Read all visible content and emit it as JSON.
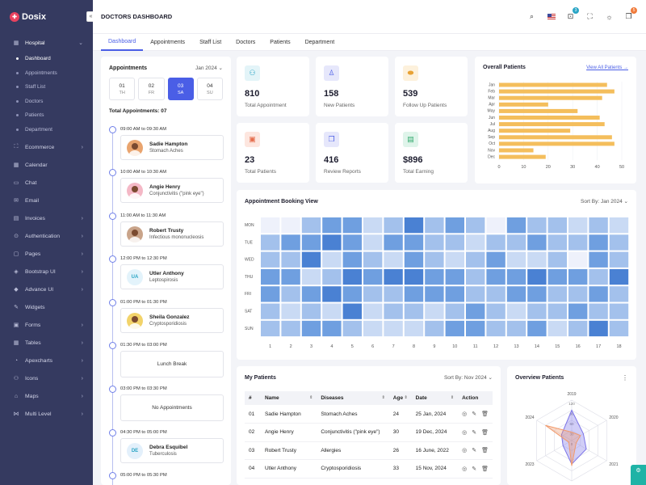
{
  "app": {
    "logo_text": "Dosix",
    "collapse_icon": "«"
  },
  "sidebar": {
    "group_label": "Hospital",
    "subitems": [
      "Dashboard",
      "Appointments",
      "Staff List",
      "Doctors",
      "Patients",
      "Department"
    ],
    "items": [
      {
        "label": "Ecommerce",
        "icon": "cart-icon",
        "glyph": "⛶",
        "chevron": true
      },
      {
        "label": "Calendar",
        "icon": "calendar-icon",
        "glyph": "▦",
        "chevron": false
      },
      {
        "label": "Chat",
        "icon": "chat-icon",
        "glyph": "▭",
        "chevron": false
      },
      {
        "label": "Email",
        "icon": "email-icon",
        "glyph": "✉",
        "chevron": false
      },
      {
        "label": "Invoices",
        "icon": "invoice-icon",
        "glyph": "▤",
        "chevron": true
      },
      {
        "label": "Authentication",
        "icon": "lock-icon",
        "glyph": "⊙",
        "chevron": true
      },
      {
        "label": "Pages",
        "icon": "pages-icon",
        "glyph": "▢",
        "chevron": true
      },
      {
        "label": "Bootstrap UI",
        "icon": "box-icon",
        "glyph": "◈",
        "chevron": true
      },
      {
        "label": "Advance UI",
        "icon": "layers-icon",
        "glyph": "◆",
        "chevron": true
      },
      {
        "label": "Widgets",
        "icon": "widgets-icon",
        "glyph": "✎",
        "chevron": false
      },
      {
        "label": "Forms",
        "icon": "forms-icon",
        "glyph": "▣",
        "chevron": true
      },
      {
        "label": "Tables",
        "icon": "table-icon",
        "glyph": "▦",
        "chevron": true
      },
      {
        "label": "Apexcharts",
        "icon": "chart-icon",
        "glyph": "◔",
        "chevron": true
      },
      {
        "label": "Icons",
        "icon": "star-icon",
        "glyph": "⚇",
        "chevron": true
      },
      {
        "label": "Maps",
        "icon": "map-icon",
        "glyph": "⌂",
        "chevron": true
      },
      {
        "label": "Multi Level",
        "icon": "share-icon",
        "glyph": "⋈",
        "chevron": true
      }
    ]
  },
  "header": {
    "title": "DOCTORS DASHBOARD",
    "cart_badge": "3",
    "notif_badge": "5"
  },
  "tabs": [
    "Dashboard",
    "Appointments",
    "Staff List",
    "Doctors",
    "Patients",
    "Department"
  ],
  "appointments": {
    "title": "Appointments",
    "month": "Jan 2024",
    "days": [
      {
        "num": "01",
        "dow": "TH"
      },
      {
        "num": "02",
        "dow": "FR"
      },
      {
        "num": "03",
        "dow": "SA"
      },
      {
        "num": "04",
        "dow": "SU"
      }
    ],
    "total": "Total Appointments: 07",
    "slots": [
      {
        "time": "09:00 AM to 09:30 AM",
        "name": "Sadie Hampton",
        "disease": "Stomach Aches",
        "avatar": "photo",
        "avatar_color": "#e9a46e"
      },
      {
        "time": "10:00 AM to 10:30 AM",
        "name": "Angie Henry",
        "disease": "Conjunctivitis (\"pink eye\")",
        "avatar": "photo",
        "avatar_color": "#f4b8c6"
      },
      {
        "time": "11:00 AM to 11:30 AM",
        "name": "Robert Trusty",
        "disease": "Infectious mononucleosis",
        "avatar": "photo",
        "avatar_color": "#c9a48a"
      },
      {
        "time": "12:00 PM to 12:30 PM",
        "name": "Utler Anthony",
        "disease": "Leptospirosis",
        "avatar": "UA",
        "avatar_color": "#e3f3fb"
      },
      {
        "time": "01:00 PM to 01:30 PM",
        "name": "Sheila Gonzalez",
        "disease": "Cryptosporidiosis",
        "avatar": "photo",
        "avatar_color": "#f2d36a"
      },
      {
        "time": "01:30 PM to 03:00 PM",
        "note": "Lunch Break"
      },
      {
        "time": "03:00 PM to 03:30 PM",
        "note": "No Appointments"
      },
      {
        "time": "04:30 PM to 05:00 PM",
        "name": "Debra Esquibel",
        "disease": "Tuberculosis",
        "avatar": "DE",
        "avatar_color": "#e3f0fb"
      },
      {
        "time": "05:00 PM to 05:30 PM"
      }
    ]
  },
  "stats": [
    {
      "value": "810",
      "label": "Total Appointment",
      "icon": "users-icon",
      "glyph": "⚇",
      "bg": "#e3f4f8",
      "fg": "#2aa5c5"
    },
    {
      "value": "158",
      "label": "New Patients",
      "icon": "user-icon",
      "glyph": "♙",
      "bg": "#e6e7fb",
      "fg": "#4a5ee6"
    },
    {
      "value": "539",
      "label": "Follow Up Patients",
      "icon": "pill-icon",
      "glyph": "⬬",
      "bg": "#fdf1dc",
      "fg": "#e8a235"
    },
    {
      "value": "23",
      "label": "Total Patients",
      "icon": "monitor-icon",
      "glyph": "▣",
      "bg": "#fde6df",
      "fg": "#e56b4b"
    },
    {
      "value": "416",
      "label": "Review Reports",
      "icon": "files-icon",
      "glyph": "❐",
      "bg": "#e6e7fb",
      "fg": "#4a5ee6"
    },
    {
      "value": "$896",
      "label": "Total Earning",
      "icon": "wallet-icon",
      "glyph": "▤",
      "bg": "#dff4ea",
      "fg": "#2fa86b"
    }
  ],
  "overall": {
    "title": "Overall Patients",
    "link": "View All Patients →"
  },
  "heatmap_card": {
    "title": "Appointment Booking View",
    "sort_label": "Sort By:",
    "sort_value": "Jan 2024"
  },
  "patients": {
    "title": "My Patients",
    "sort_label": "Sort By:",
    "sort_value": "Nov 2024",
    "columns": [
      "#",
      "Name",
      "Diseases",
      "Age",
      "Date",
      "Action"
    ],
    "rows": [
      [
        "01",
        "Sadie Hampton",
        "Stomach Aches",
        "24",
        "25 Jan, 2024"
      ],
      [
        "02",
        "Angie Henry",
        "Conjunctivitis (\"pink eye\")",
        "30",
        "19 Dec, 2024"
      ],
      [
        "03",
        "Robert Trusty",
        "Allergies",
        "26",
        "16 June, 2022"
      ],
      [
        "04",
        "Utler Anthony",
        "Cryptosporidiosis",
        "33",
        "15 Nov, 2024"
      ]
    ]
  },
  "overview": {
    "title": "Overview Patients"
  },
  "chart_data": [
    {
      "type": "bar",
      "orientation": "horizontal",
      "categories": [
        "Jan",
        "Feb",
        "Mar",
        "Apr",
        "May",
        "Jun",
        "Jul",
        "Aug",
        "Sep",
        "Oct",
        "Nov",
        "Dec"
      ],
      "values": [
        44,
        47,
        42,
        20,
        32,
        41,
        43,
        29,
        46,
        47,
        14,
        19
      ],
      "xlim": [
        0,
        50
      ],
      "xticks": [
        0,
        10,
        20,
        30,
        40,
        50
      ],
      "color": "#f4be5c"
    },
    {
      "type": "heatmap",
      "rows": [
        "MON",
        "TUE",
        "WED",
        "THU",
        "FRI",
        "SAT",
        "SUN"
      ],
      "columns": [
        "1",
        "2",
        "3",
        "4",
        "5",
        "6",
        "7",
        "8",
        "9",
        "10",
        "11",
        "12",
        "13",
        "14",
        "15",
        "16",
        "17",
        "18"
      ],
      "values": [
        [
          0,
          0,
          2,
          3,
          3,
          1,
          2,
          4,
          2,
          3,
          2,
          0,
          3,
          2,
          2,
          1,
          2,
          1
        ],
        [
          2,
          3,
          3,
          4,
          3,
          1,
          3,
          3,
          2,
          2,
          1,
          2,
          2,
          3,
          2,
          2,
          3,
          2
        ],
        [
          2,
          2,
          4,
          1,
          3,
          2,
          1,
          3,
          2,
          1,
          2,
          3,
          1,
          1,
          2,
          0,
          3,
          2
        ],
        [
          3,
          3,
          1,
          2,
          4,
          3,
          4,
          4,
          3,
          3,
          2,
          3,
          3,
          4,
          3,
          3,
          2,
          4
        ],
        [
          3,
          2,
          3,
          4,
          3,
          2,
          2,
          3,
          3,
          3,
          2,
          2,
          3,
          3,
          2,
          2,
          3,
          2
        ],
        [
          2,
          1,
          2,
          1,
          4,
          1,
          2,
          2,
          1,
          2,
          3,
          2,
          1,
          2,
          2,
          3,
          2,
          2
        ],
        [
          2,
          2,
          3,
          3,
          2,
          1,
          1,
          1,
          2,
          3,
          3,
          2,
          2,
          3,
          1,
          2,
          4,
          2
        ]
      ],
      "palette": [
        "#eef1fb",
        "#c9daf4",
        "#a3c1ec",
        "#6f9fe0",
        "#4a81d3"
      ]
    },
    {
      "type": "radar",
      "axes": [
        "2019",
        "2020",
        "2021",
        "2022",
        "2023",
        "2024"
      ],
      "ticks": [
        "120",
        "90",
        "60",
        "30",
        "0"
      ],
      "max": 120,
      "series": [
        {
          "values": [
            90,
            40,
            50,
            70,
            30,
            35
          ],
          "color": "#7b73e8"
        },
        {
          "values": [
            25,
            30,
            15,
            75,
            10,
            90
          ],
          "color": "#f2996a"
        }
      ]
    }
  ]
}
